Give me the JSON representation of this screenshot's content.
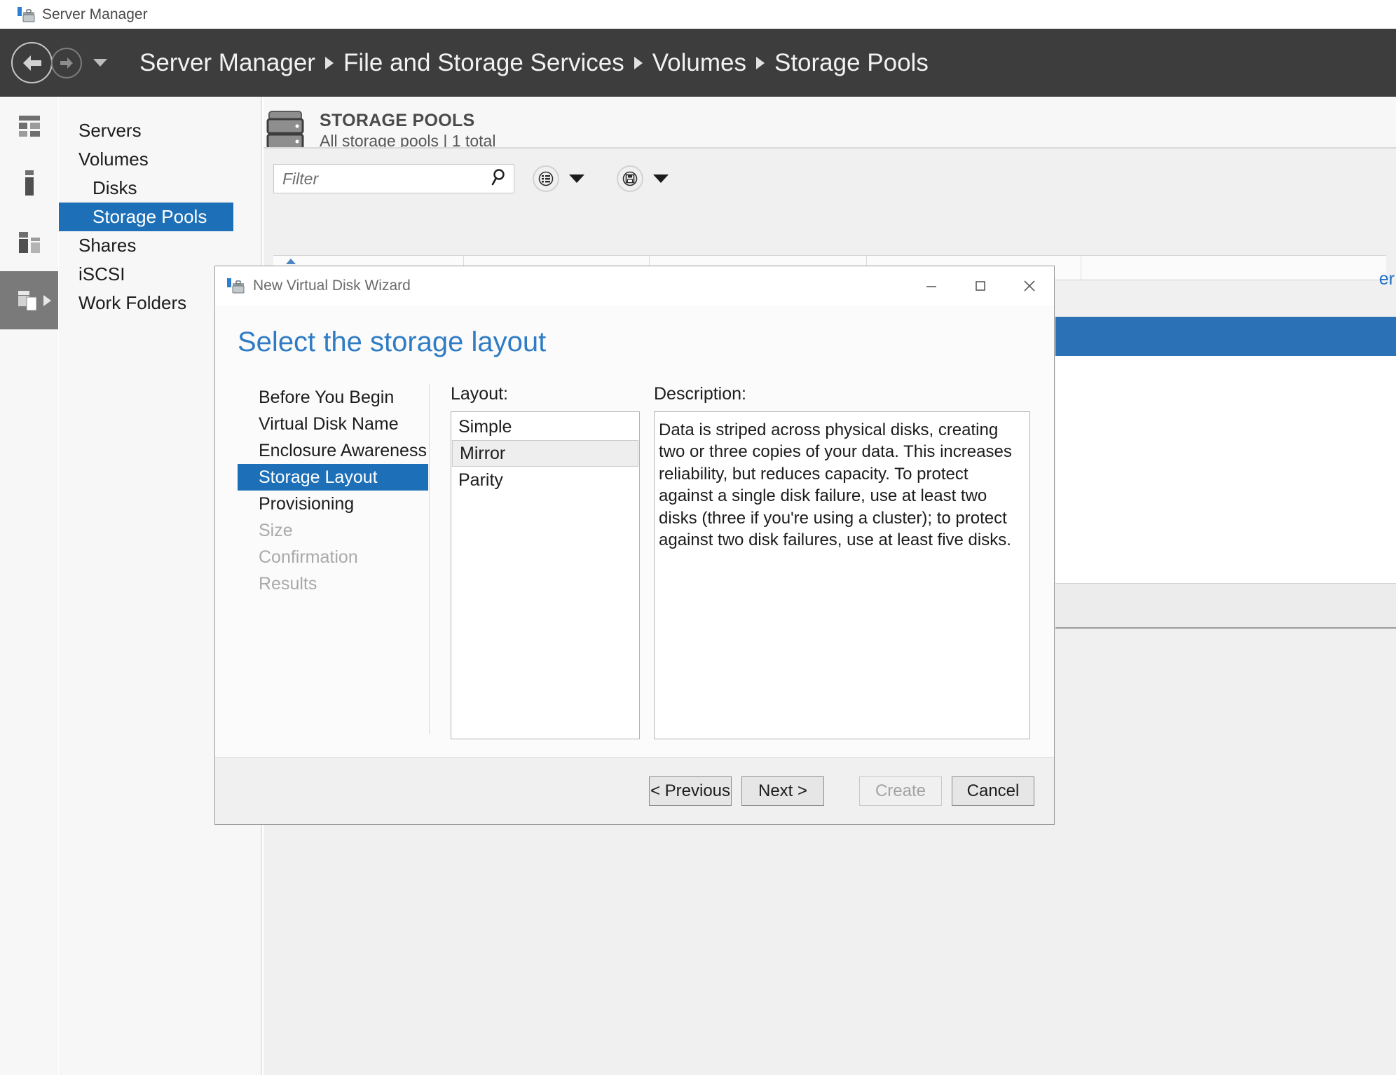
{
  "app": {
    "title": "Server Manager",
    "icon": "server-manager-icon"
  },
  "breadcrumb": {
    "back_icon": "back-arrow-icon",
    "forward_icon": "forward-arrow-icon",
    "dropdown_icon": "chevron-down-icon",
    "items": [
      "Server Manager",
      "File and Storage Services",
      "Volumes",
      "Storage Pools"
    ]
  },
  "icon_rail": {
    "items": [
      {
        "name": "dashboard-icon"
      },
      {
        "name": "local-server-icon"
      },
      {
        "name": "all-servers-icon"
      },
      {
        "name": "file-storage-services-icon"
      }
    ]
  },
  "nav": {
    "items": [
      {
        "label": "Servers",
        "indent": false,
        "selected": false
      },
      {
        "label": "Volumes",
        "indent": false,
        "selected": false
      },
      {
        "label": "Disks",
        "indent": true,
        "selected": false
      },
      {
        "label": "Storage Pools",
        "indent": true,
        "selected": true
      },
      {
        "label": "Shares",
        "indent": false,
        "selected": false
      },
      {
        "label": "iSCSI",
        "indent": false,
        "selected": false
      },
      {
        "label": "Work Folders",
        "indent": false,
        "selected": false
      }
    ]
  },
  "main": {
    "panel_icon": "storage-pool-icon",
    "title": "STORAGE POOLS",
    "subtitle": "All storage pools | 1 total",
    "filter": {
      "placeholder": "Filter",
      "value": "",
      "search_icon": "search-icon"
    },
    "toolbar": [
      {
        "icon": "list-view-icon",
        "caret": "chevron-down-icon"
      },
      {
        "icon": "save-icon",
        "caret": "chevron-down-icon"
      }
    ],
    "background_link": "er"
  },
  "dialog": {
    "icon": "wizard-icon",
    "title": "New Virtual Disk Wizard",
    "window_buttons": {
      "minimize": "minimize-icon",
      "maximize": "maximize-icon",
      "close": "close-icon"
    },
    "heading": "Select the storage layout",
    "steps": [
      {
        "label": "Before You Begin",
        "state": "done"
      },
      {
        "label": "Virtual Disk Name",
        "state": "done"
      },
      {
        "label": "Enclosure Awareness",
        "state": "done"
      },
      {
        "label": "Storage Layout",
        "state": "current"
      },
      {
        "label": "Provisioning",
        "state": "done"
      },
      {
        "label": "Size",
        "state": "disabled"
      },
      {
        "label": "Confirmation",
        "state": "disabled"
      },
      {
        "label": "Results",
        "state": "disabled"
      }
    ],
    "layout": {
      "label": "Layout:",
      "options": [
        {
          "label": "Simple",
          "selected": false
        },
        {
          "label": "Mirror",
          "selected": true
        },
        {
          "label": "Parity",
          "selected": false
        }
      ]
    },
    "description": {
      "label": "Description:",
      "text": "Data is striped across physical disks, creating two or three copies of your data. This increases reliability, but reduces capacity. To protect against a single disk failure, use at least two disks (three if you're using a cluster); to protect against two disk failures, use at least five disks."
    },
    "buttons": {
      "previous": "< Previous",
      "next": "Next >",
      "create": "Create",
      "cancel": "Cancel"
    }
  }
}
